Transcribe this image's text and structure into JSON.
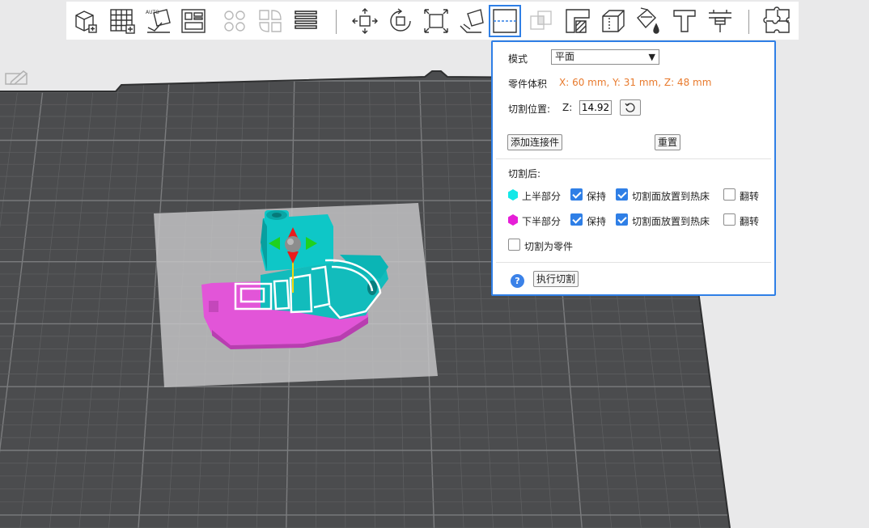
{
  "cut_panel": {
    "mode_label": "模式",
    "mode_value": "平面",
    "volume_label": "零件体积",
    "volume_value": "X: 60 mm,  Y: 31 mm,  Z: 48 mm",
    "cut_position_label": "切割位置:",
    "z_label": "Z:",
    "z_value": "14.92",
    "add_connector": "添加连接件",
    "reset": "重置",
    "after_cut_label": "切割后:",
    "upper": {
      "label": "上半部分",
      "keep": "保持",
      "keep_checked": true,
      "place_on_bed": "切割面放置到热床",
      "place_checked": true,
      "flip": "翻转",
      "flip_checked": false,
      "color": "#14e8e8"
    },
    "lower": {
      "label": "下半部分",
      "keep": "保持",
      "keep_checked": true,
      "place_on_bed": "切割面放置到热床",
      "place_checked": true,
      "flip": "翻转",
      "flip_checked": false,
      "color": "#e61ed7"
    },
    "cut_to_parts": "切割为零件",
    "cut_to_parts_checked": false,
    "help_glyph": "?",
    "execute": "执行切割"
  },
  "toolbar": {
    "active_tool": "cut-icon",
    "icons": [
      "add-object-icon",
      "add-plate-icon",
      "auto-orient-icon",
      "arrange-icon",
      "split-objects-icon",
      "split-parts-icon",
      "layers-icon",
      "move-icon",
      "rotate-icon",
      "scale-icon",
      "lay-on-face-icon",
      "cut-icon",
      "boolean-icon",
      "support-paint-icon",
      "seam-paint-icon",
      "color-paint-icon",
      "text-icon",
      "measure-icon",
      "assembly-icon"
    ],
    "auto_badge": "AUTO"
  },
  "colors": {
    "plate": "#4b4c4e",
    "teal": "#0ec7c7",
    "magenta": "#e255d8",
    "accent": "#2f7fe6",
    "orange": "#e87a2d"
  }
}
